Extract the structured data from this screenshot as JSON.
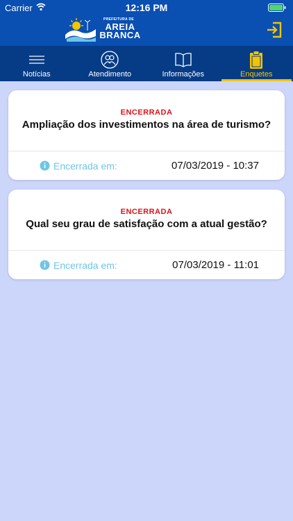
{
  "status_bar": {
    "carrier": "Carrier",
    "time": "12:16 PM",
    "icons": [
      "wifi-icon",
      "battery-icon"
    ]
  },
  "header": {
    "logo": {
      "line_small": "PREFEITURA DE",
      "line1": "AREIA",
      "line2": "BRANCA"
    },
    "logout_icon": "logout-icon"
  },
  "tabs": [
    {
      "label": "Notícias",
      "icon": "menu-lines-icon",
      "active": false
    },
    {
      "label": "Atendimento",
      "icon": "people-icon",
      "active": false
    },
    {
      "label": "Informações",
      "icon": "book-icon",
      "active": false
    },
    {
      "label": "Enquetes",
      "icon": "clipboard-icon",
      "active": true
    }
  ],
  "polls": [
    {
      "status": "ENCERRADA",
      "question": "Ampliação dos investimentos na área de turismo?",
      "closed_label": "Encerrada em:",
      "closed_date": "07/03/2019 - 10:37"
    },
    {
      "status": "ENCERRADA",
      "question": "Qual seu grau de satisfação com a atual gestão?",
      "closed_label": "Encerrada em:",
      "closed_date": "07/03/2019 - 11:01"
    }
  ],
  "colors": {
    "header": "#0a4fb2",
    "tab_bar": "#063b86",
    "accent": "#f5c400",
    "background": "#ccd6fb",
    "status_closed": "#e0101a",
    "info": "#6ec6e6"
  }
}
